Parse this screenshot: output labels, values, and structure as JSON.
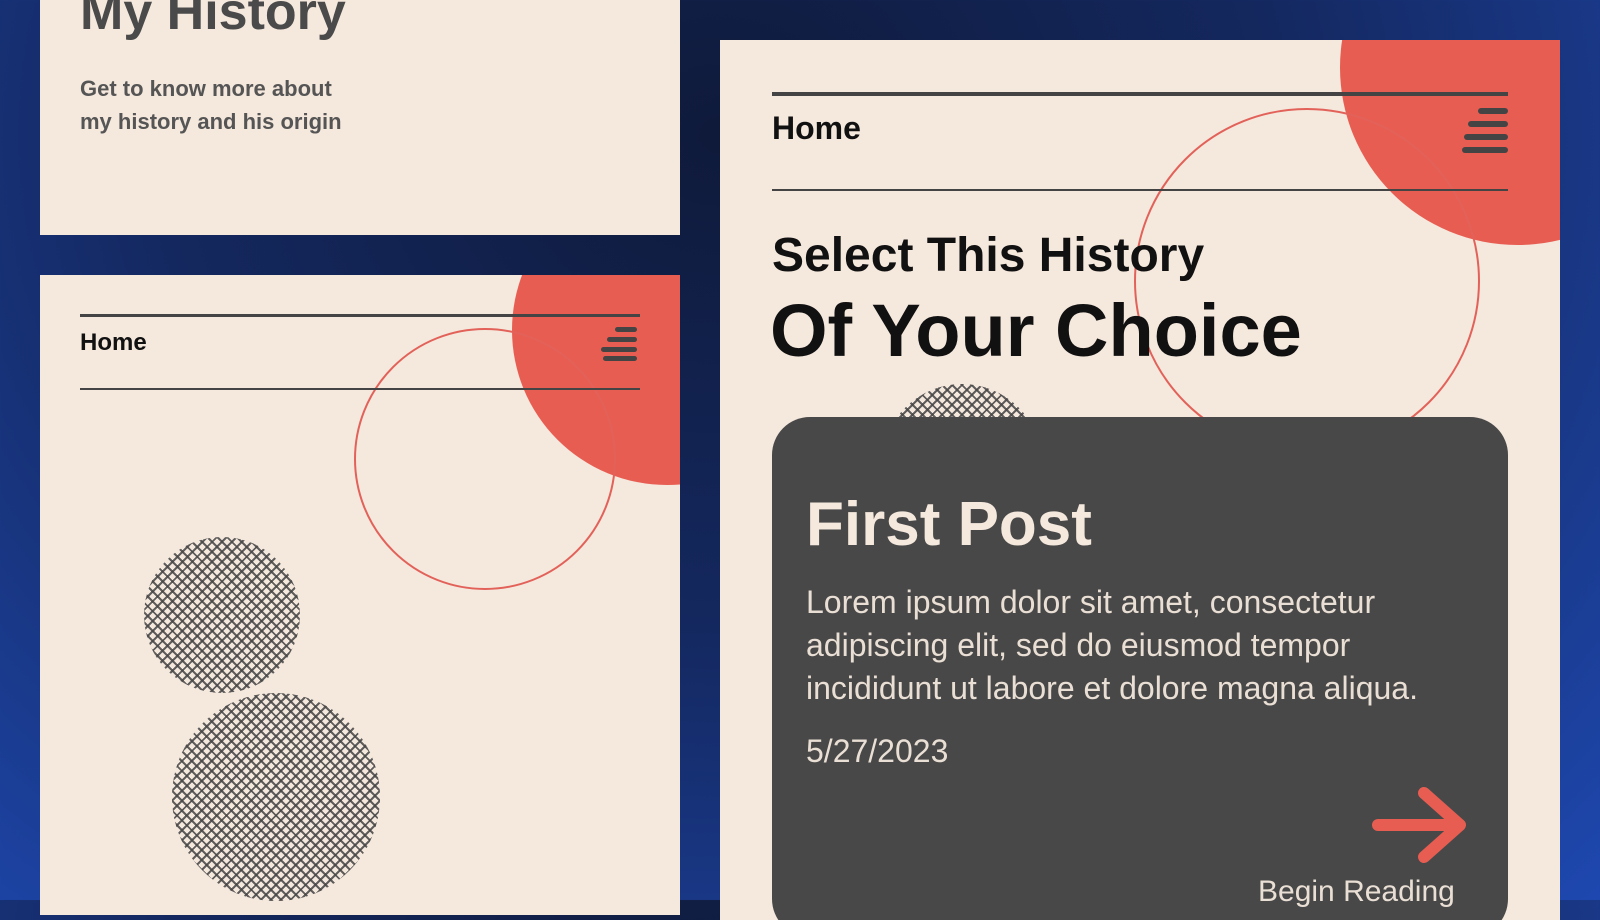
{
  "card_history": {
    "title": "My History",
    "subtitle_line1": "Get to know more about",
    "subtitle_line2": "my history and his origin"
  },
  "card_home_small": {
    "nav_label": "Home",
    "menu_icon": "hamburger-menu-icon"
  },
  "card_home_large": {
    "nav_label": "Home",
    "menu_icon": "hamburger-menu-icon",
    "heading_line1": "Select This History",
    "heading_line2": "Of Your Choice",
    "post": {
      "title": "First Post",
      "body": "Lorem ipsum dolor sit amet, consectetur adipiscing elit, sed do eiusmod tempor incididunt ut labore et dolore magna aliqua.",
      "date": "5/27/2023",
      "arrow_icon": "arrow-right-icon",
      "action_label": "Begin Reading"
    }
  },
  "colors": {
    "background": "#1e48b0",
    "card": "#f5e8dd",
    "accent": "#e85d52",
    "post_card": "#484848",
    "text_dark": "#111111"
  }
}
